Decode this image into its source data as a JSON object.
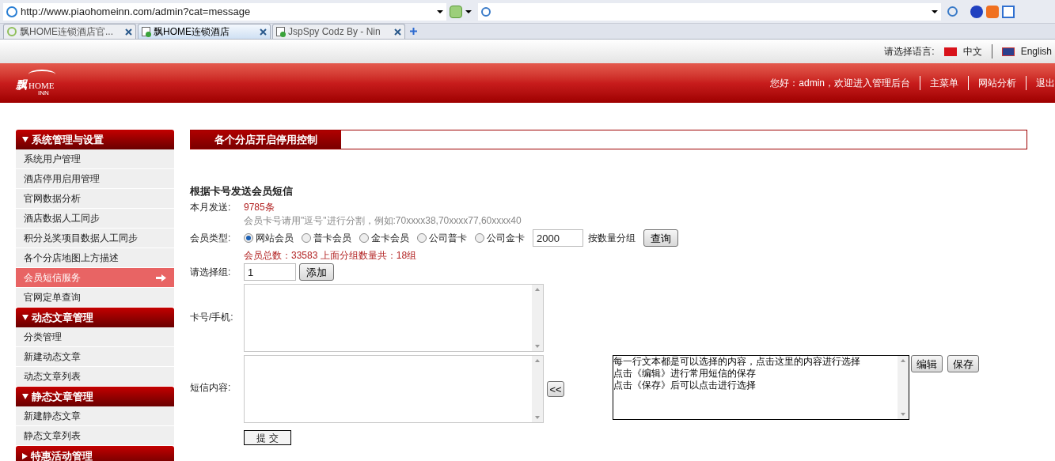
{
  "browser": {
    "address": "http://www.piaohomeinn.com/admin?cat=message",
    "tabs": [
      {
        "label": "飘HOME连锁酒店官...",
        "selected": false,
        "kind": "loading"
      },
      {
        "label": "飘HOME连锁酒店",
        "selected": true,
        "kind": "page"
      },
      {
        "label": "JspSpy Codz By - Nin",
        "selected": false,
        "kind": "page"
      }
    ]
  },
  "language_bar": {
    "label": "请选择语言:",
    "options": [
      "中文",
      "English"
    ]
  },
  "header": {
    "logo": {
      "mark": "飘",
      "name": "HOME",
      "sub": "INN"
    },
    "greeting": "您好：admin，欢迎进入管理后台",
    "links": [
      "主菜单",
      "网站分析",
      "退出"
    ]
  },
  "sidebar": {
    "groups": [
      {
        "title": "系统管理与设置",
        "expanded": true,
        "items": [
          {
            "label": "系统用户管理",
            "selected": false
          },
          {
            "label": "酒店停用启用管理",
            "selected": false
          },
          {
            "label": "官网数据分析",
            "selected": false
          },
          {
            "label": "酒店数据人工同步",
            "selected": false
          },
          {
            "label": "积分兑奖项目数据人工同步",
            "selected": false
          },
          {
            "label": "各个分店地图上方描述",
            "selected": false
          },
          {
            "label": "会员短信服务",
            "selected": true
          },
          {
            "label": "官网定单查询",
            "selected": false
          }
        ]
      },
      {
        "title": "动态文章管理",
        "expanded": true,
        "items": [
          {
            "label": "分类管理",
            "selected": false
          },
          {
            "label": "新建动态文章",
            "selected": false
          },
          {
            "label": "动态文章列表",
            "selected": false
          }
        ]
      },
      {
        "title": "静态文章管理",
        "expanded": true,
        "items": [
          {
            "label": "新建静态文章",
            "selected": false
          },
          {
            "label": "静态文章列表",
            "selected": false
          }
        ]
      },
      {
        "title": "特惠活动管理",
        "expanded": false
      }
    ]
  },
  "content": {
    "tab_title": "各个分店开启停用控制",
    "form_title": "根据卡号发送会员短信",
    "sent_label": "本月发送:",
    "sent_value": "9785条",
    "hint": "会员卡号请用\"逗号\"进行分割，例如:70xxxx38,70xxxx77,60xxxx40",
    "type_label": "会员类型:",
    "member_types": [
      {
        "label": "网站会员",
        "selected": true
      },
      {
        "label": "普卡会员",
        "selected": false
      },
      {
        "label": "金卡会员",
        "selected": false
      },
      {
        "label": "公司普卡",
        "selected": false
      },
      {
        "label": "公司金卡",
        "selected": false
      }
    ],
    "group_size": "2000",
    "group_size_label": "按数量分组",
    "query_button": "查询",
    "total": "会员总数：33583 上面分组数量共：18组",
    "group_label": "请选择组:",
    "group_value": "1",
    "add_button": "添加",
    "card_label": "卡号/手机:",
    "sms_label": "短信内容:",
    "insert_button": "<<",
    "templates": [
      "每一行文本都是可以选择的内容，点击这里的内容进行选择",
      "点击《编辑》进行常用短信的保存",
      "点击《保存》后可以点击进行选择"
    ],
    "edit_button": "编辑",
    "save_button": "保存",
    "submit_button": "提 交"
  }
}
